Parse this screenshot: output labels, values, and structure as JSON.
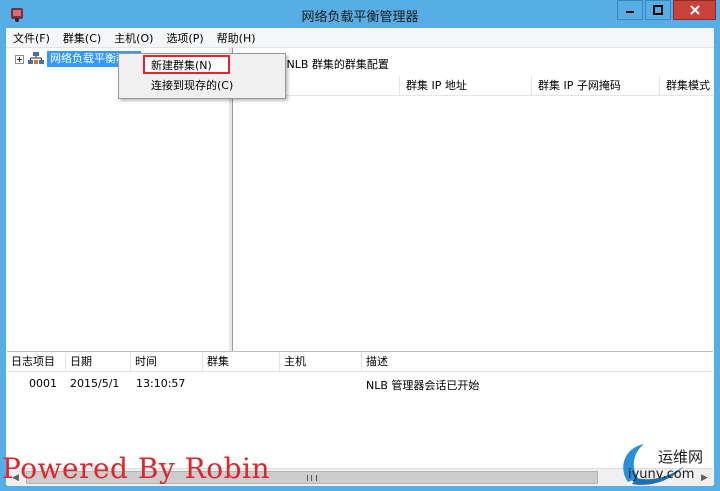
{
  "window": {
    "title": "网络负载平衡管理器"
  },
  "menubar": {
    "items": [
      "文件(F)",
      "群集(C)",
      "主机(O)",
      "选项(P)",
      "帮助(H)"
    ]
  },
  "tree": {
    "root_label": "网络负载平衡群集"
  },
  "right_pane": {
    "header": "的 NLB 群集的群集配置",
    "columns": [
      "",
      "群集 IP 地址",
      "群集 IP 子网掩码",
      "群集模式"
    ]
  },
  "context_menu": {
    "items": [
      "新建群集(N)",
      "连接到现存的(C)"
    ]
  },
  "log": {
    "columns": [
      "日志项目",
      "日期",
      "时间",
      "群集",
      "主机",
      "描述"
    ],
    "rows": [
      {
        "id": "0001",
        "date": "2015/5/1",
        "time": "13:10:57",
        "cluster": "",
        "host": "",
        "desc": "NLB 管理器会话已开始"
      }
    ]
  },
  "watermark": "Powered By Robin",
  "logo": {
    "cn": "运维网",
    "url": "iyunv.com"
  },
  "colors": {
    "titlebar": "#57aee6",
    "close": "#c8413b",
    "selection": "#3399ff",
    "highlight_border": "#e0262f",
    "watermark": "#e1232b"
  }
}
